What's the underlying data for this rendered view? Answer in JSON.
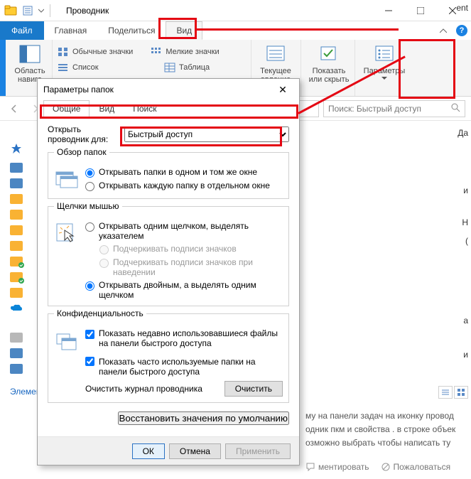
{
  "titlebar": {
    "title": "Проводник"
  },
  "tabs": {
    "file": "Файл",
    "home": "Главная",
    "share": "Поделиться",
    "view": "Вид"
  },
  "ribbon": {
    "nav_panel": "Область\nнавига",
    "icons": {
      "normal": "Обычные значки",
      "small": "Мелкие значки",
      "list": "Список",
      "table": "Таблица"
    },
    "current": "Текущее\nавление",
    "show_hide": "Показать\nили скрыть",
    "options": "Параметры"
  },
  "search": {
    "placeholder": "Поиск: Быстрый доступ"
  },
  "elements_label": "Элемен",
  "dialog": {
    "title": "Параметры папок",
    "tabs": {
      "general": "Общие",
      "view": "Вид",
      "search": "Поиск"
    },
    "open_label": "Открыть проводник для:",
    "open_value": "Быстрый доступ",
    "group_browse": "Обзор папок",
    "browse_same": "Открывать папки в одном и том же окне",
    "browse_new": "Открывать каждую папку в отдельном окне",
    "group_click": "Щелчки мышью",
    "click_single": "Открывать одним щелчком, выделять указателем",
    "click_underline_icons": "Подчеркивать подписи значков",
    "click_underline_hover": "Подчеркивать подписи значков при наведении",
    "click_double": "Открывать двойным, а выделять одним щелчком",
    "group_privacy": "Конфиденциальность",
    "privacy_files": "Показать недавно использовавшиеся файлы на панели быстрого доступа",
    "privacy_folders": "Показать часто используемые папки на панели быстрого доступа",
    "clear_label": "Очистить журнал проводника",
    "clear_btn": "Очистить",
    "restore": "Восстановить значения по умолчанию",
    "ok": "ОК",
    "cancel": "Отмена",
    "apply": "Применить"
  },
  "behind_text": "му на панели задач на иконку провод\nодник пкм и свойства . в строке объек\nозможно выбрать чтобы написать ту",
  "behind_meta": {
    "comment": "ментировать",
    "complain": "Пожаловаться"
  },
  "right_fragments": {
    "f1": "ent",
    "f2": "Да",
    "f3": "и",
    "f4": "Н",
    "f5": "(",
    "f6": "а",
    "f7": "и"
  }
}
